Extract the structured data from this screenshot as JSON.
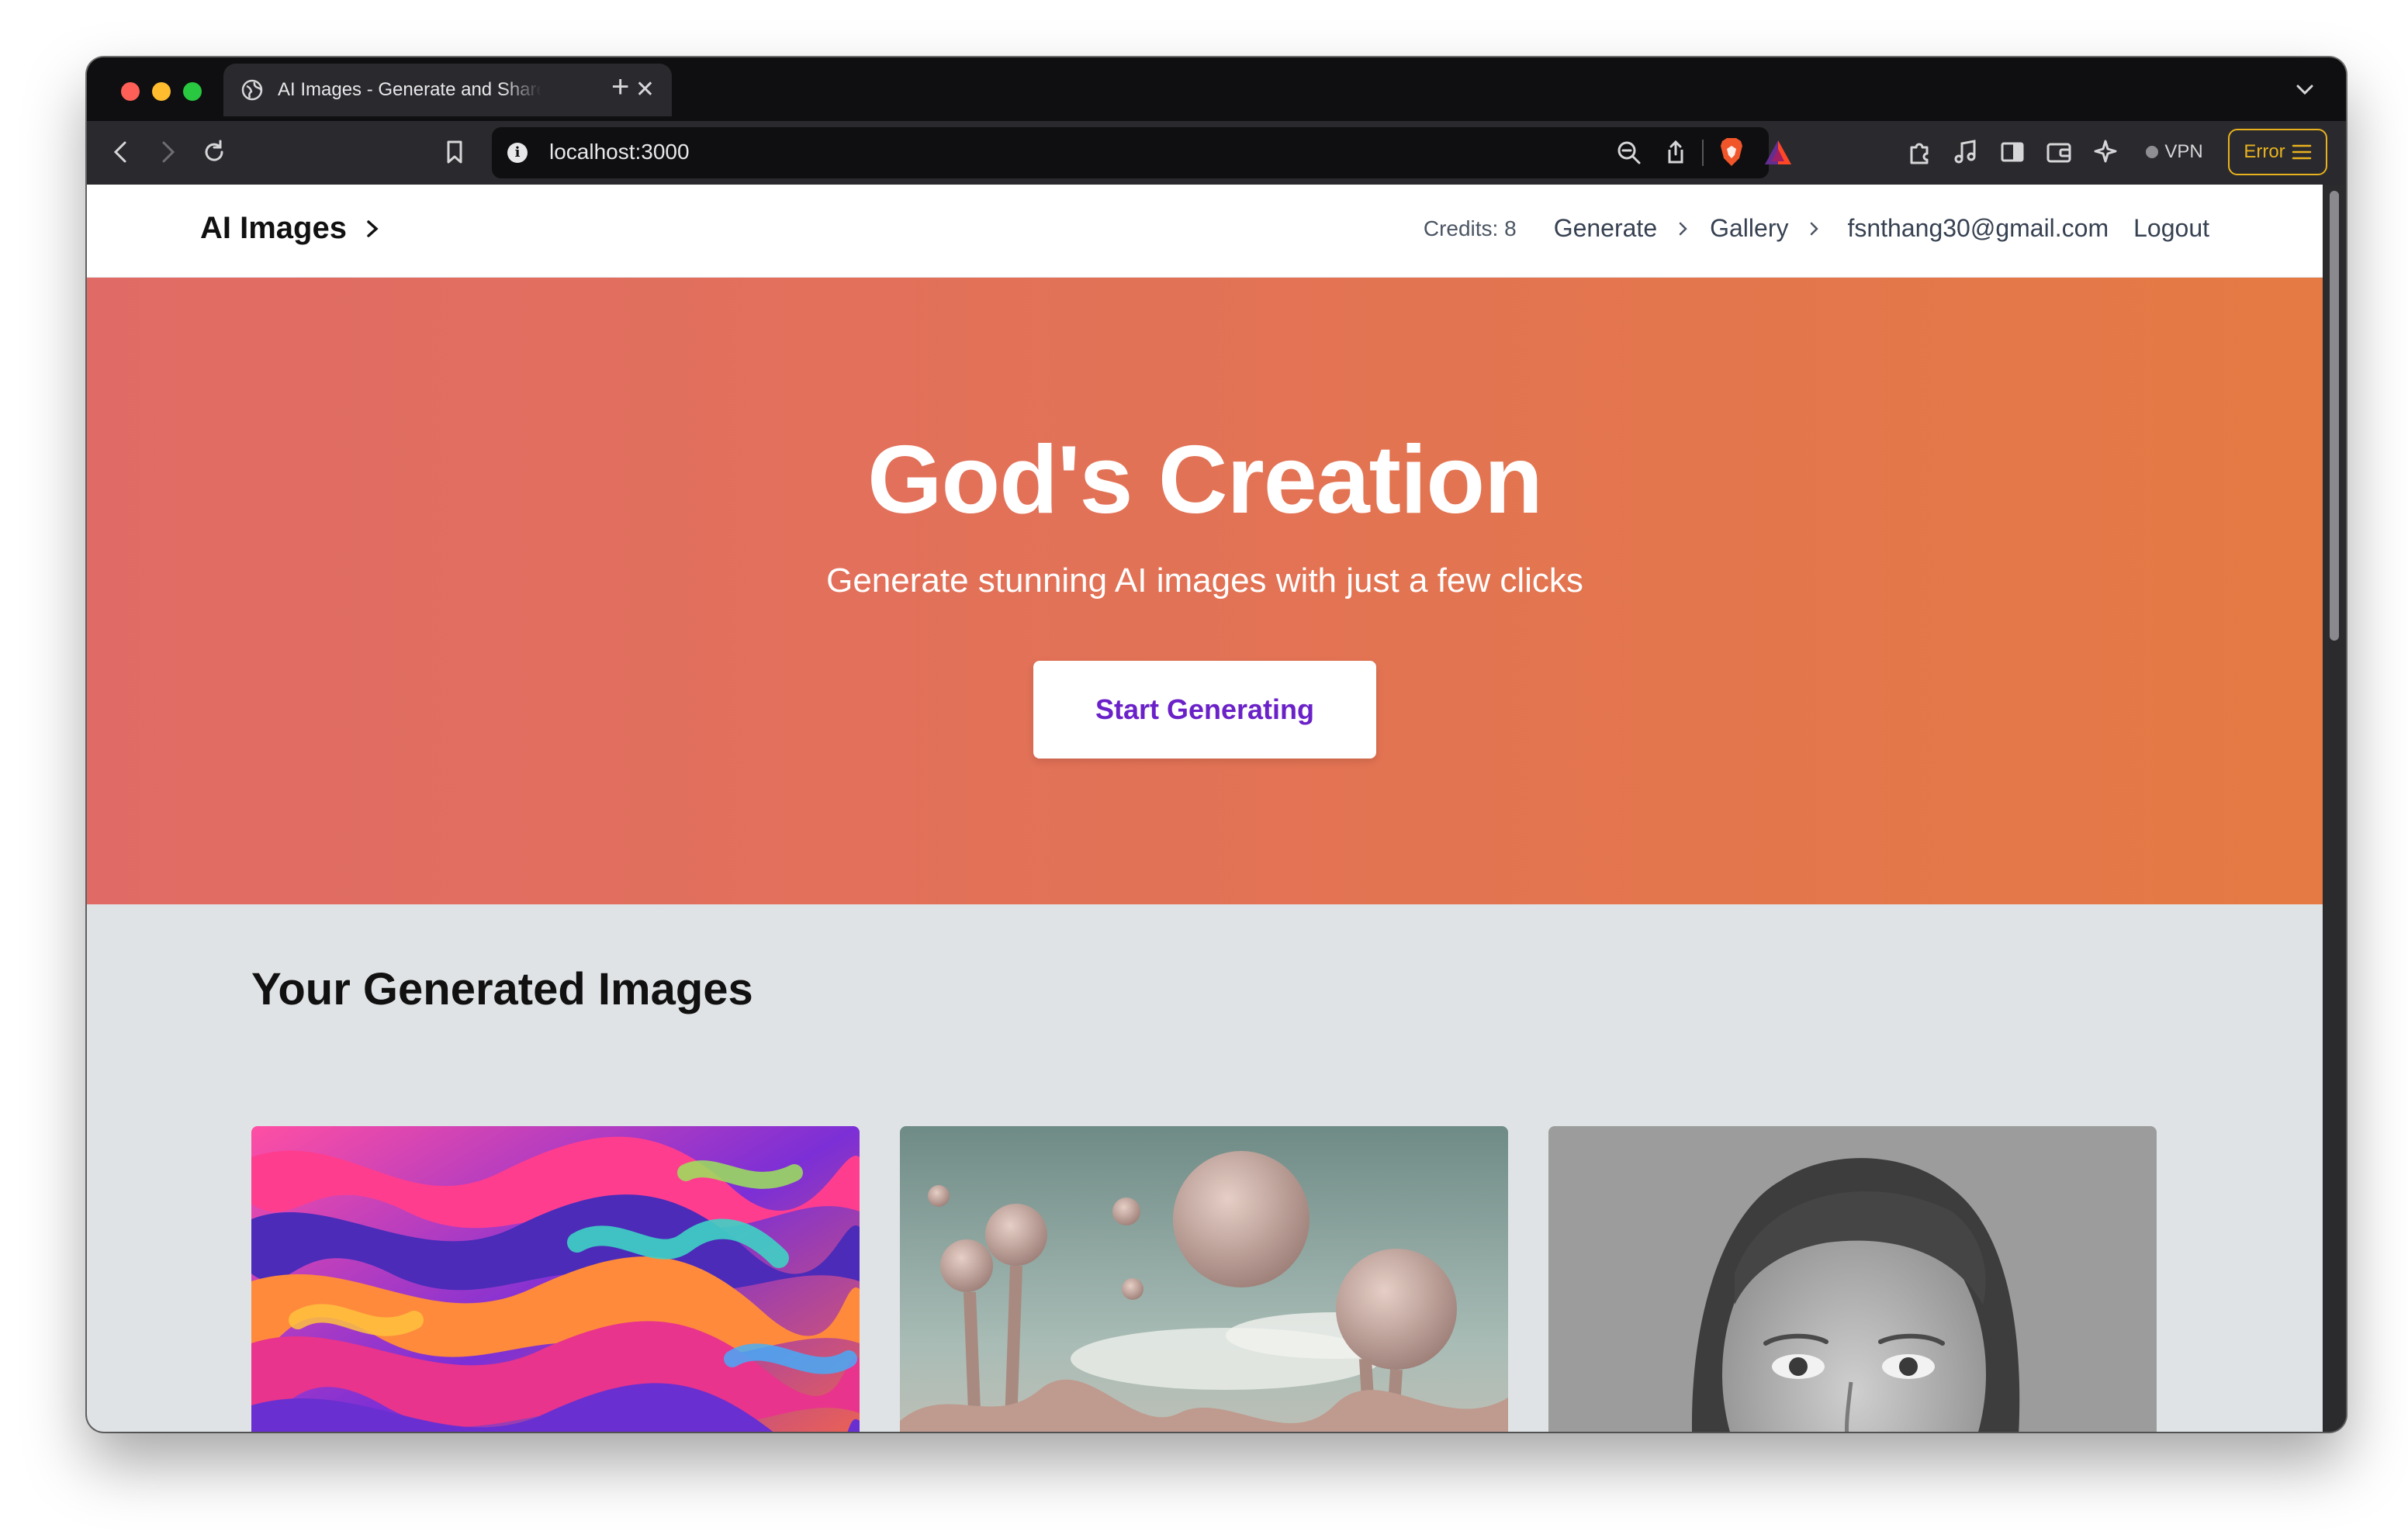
{
  "browser": {
    "tab_title": "AI Images - Generate and Share",
    "new_tab": "+",
    "tab_close": "✕",
    "url": "localhost:3000",
    "vpn_label": "VPN",
    "error_label": "Error"
  },
  "navbar": {
    "brand": "AI Images",
    "credits": "Credits: 8",
    "links": [
      "Generate",
      "Gallery"
    ],
    "email": "fsnthang30@gmail.com",
    "logout": "Logout"
  },
  "hero": {
    "title": "God's Creation",
    "subtitle": "Generate stunning AI images with just a few clicks",
    "cta": "Start Generating"
  },
  "gallery": {
    "title": "Your Generated Images",
    "images": [
      "abstract-waves",
      "floating-spheres-landscape",
      "portrait-woman"
    ]
  },
  "colors": {
    "hero_start": "#e06b66",
    "hero_end": "#e57a44",
    "cta_text": "#6b21c8",
    "error_accent": "#e8b21e"
  }
}
